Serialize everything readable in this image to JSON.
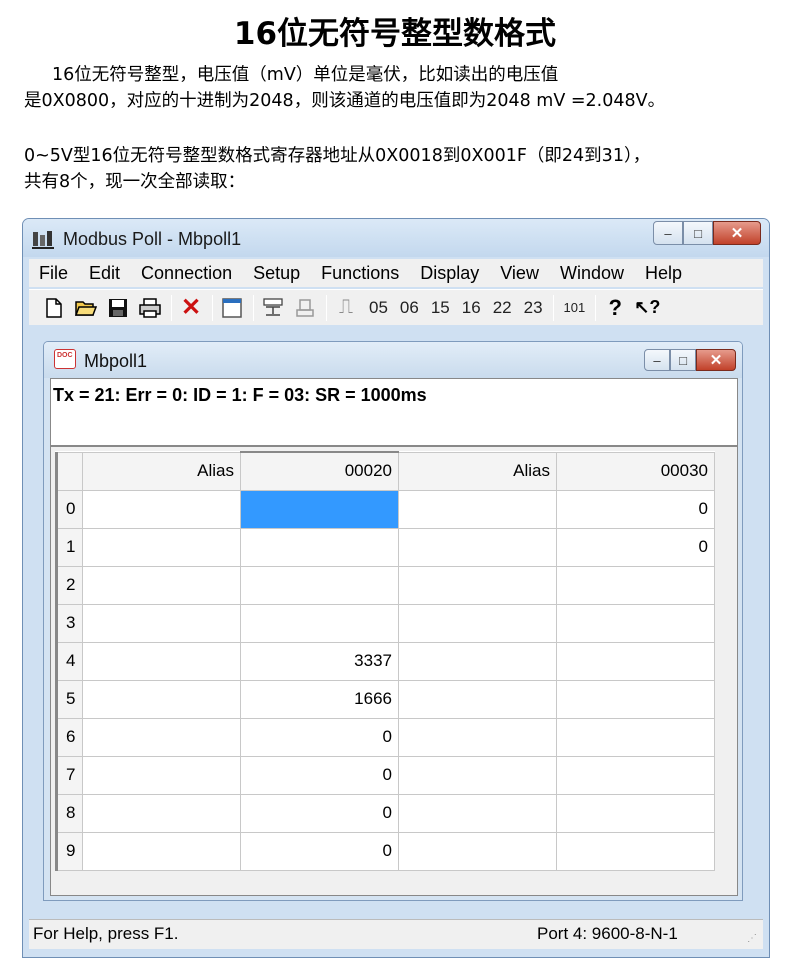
{
  "page": {
    "heading": "16位无符号整型数格式",
    "para1_line1": "16位无符号整型，电压值（mV）单位是毫伏，比如读出的电压值",
    "para1_line2": "是0X0800，对应的十进制为2048，则该通道的电压值即为2048 mV =2.048V。",
    "para2_line1": "0~5V型16位无符号整型数格式寄存器地址从0X0018到0X001F（即24到31），",
    "para2_line2": "共有8个，现一次全部读取："
  },
  "window": {
    "title": "Modbus Poll - Mbpoll1",
    "minimize": "–",
    "maximize": "□",
    "close": "✕"
  },
  "menu": {
    "file": "File",
    "edit": "Edit",
    "connection": "Connection",
    "setup": "Setup",
    "functions": "Functions",
    "display": "Display",
    "view": "View",
    "window": "Window",
    "help": "Help"
  },
  "toolbar": {
    "new_icon": "🗋",
    "open_icon": "📂",
    "save_icon": "💾",
    "print_icon": "🖶",
    "delete_icon": "✕",
    "window_icon": "▭",
    "fn05": "05",
    "fn06": "06",
    "fn15": "15",
    "fn16": "16",
    "fn22": "22",
    "fn23": "23",
    "fn101": "101",
    "help_icon": "?",
    "context_help_icon": "↖?"
  },
  "child": {
    "title": "Mbpoll1",
    "status_line": "Tx = 21: Err = 0: ID = 1: F = 03: SR = 1000ms"
  },
  "grid": {
    "headers": [
      "Alias",
      "00020",
      "Alias",
      "00030"
    ],
    "rows": [
      {
        "index": "0",
        "alias1": "",
        "v1": "",
        "alias2": "",
        "v2": "0"
      },
      {
        "index": "1",
        "alias1": "",
        "v1": "",
        "alias2": "",
        "v2": "0"
      },
      {
        "index": "2",
        "alias1": "",
        "v1": "",
        "alias2": "",
        "v2": ""
      },
      {
        "index": "3",
        "alias1": "",
        "v1": "",
        "alias2": "",
        "v2": ""
      },
      {
        "index": "4",
        "alias1": "",
        "v1": "3337",
        "alias2": "",
        "v2": ""
      },
      {
        "index": "5",
        "alias1": "",
        "v1": "1666",
        "alias2": "",
        "v2": ""
      },
      {
        "index": "6",
        "alias1": "",
        "v1": "0",
        "alias2": "",
        "v2": ""
      },
      {
        "index": "7",
        "alias1": "",
        "v1": "0",
        "alias2": "",
        "v2": ""
      },
      {
        "index": "8",
        "alias1": "",
        "v1": "0",
        "alias2": "",
        "v2": ""
      },
      {
        "index": "9",
        "alias1": "",
        "v1": "0",
        "alias2": "",
        "v2": ""
      }
    ]
  },
  "statusbar": {
    "help": "For Help, press F1.",
    "port": "Port 4: 9600-8-N-1"
  },
  "colors": {
    "selected_cell": "#3399ff",
    "close_button": "#c1412a",
    "title_bar": "#c3d8ee"
  }
}
